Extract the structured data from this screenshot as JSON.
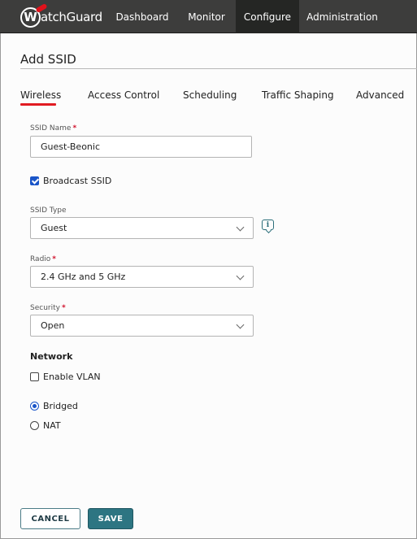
{
  "topnav": {
    "brand": "WatchGuard",
    "brand_mark": "W",
    "items": [
      {
        "label": "Dashboard",
        "active": false
      },
      {
        "label": "Monitor",
        "active": false
      },
      {
        "label": "Configure",
        "active": true
      },
      {
        "label": "Administration",
        "active": false
      }
    ]
  },
  "page": {
    "title": "Add SSID"
  },
  "tabs": [
    {
      "label": "Wireless",
      "active": true
    },
    {
      "label": "Access Control",
      "active": false
    },
    {
      "label": "Scheduling",
      "active": false
    },
    {
      "label": "Traffic Shaping",
      "active": false
    },
    {
      "label": "Advanced",
      "active": false
    }
  ],
  "form": {
    "ssid_name": {
      "label": "SSID Name",
      "required_mark": "*",
      "value": "Guest-Beonic"
    },
    "broadcast_ssid": {
      "label": "Broadcast SSID",
      "checked": true
    },
    "ssid_type": {
      "label": "SSID Type",
      "value": "Guest",
      "info_icon": "info-icon"
    },
    "radio": {
      "label": "Radio",
      "required_mark": "*",
      "value": "2.4 GHz and 5 GHz"
    },
    "security": {
      "label": "Security",
      "required_mark": "*",
      "value": "Open"
    },
    "network": {
      "heading": "Network",
      "enable_vlan": {
        "label": "Enable VLAN",
        "checked": false
      },
      "mode_options": [
        {
          "label": "Bridged",
          "selected": true
        },
        {
          "label": "NAT",
          "selected": false
        }
      ]
    }
  },
  "actions": {
    "cancel_label": "CANCEL",
    "save_label": "SAVE"
  },
  "colors": {
    "nav_bg": "#3d3d3c",
    "nav_active_bg": "#252624",
    "tab_underline": "#e11b22",
    "required": "#d0112b",
    "control_blue": "#1a55c8",
    "save_bg": "#2d7582"
  }
}
